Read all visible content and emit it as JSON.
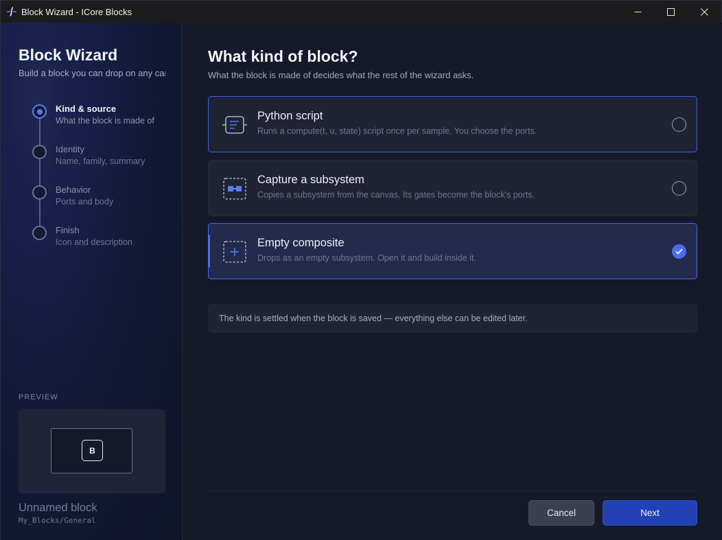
{
  "window": {
    "title": "Block Wizard - ICore Blocks",
    "icons": {
      "app": "app-logo-icon",
      "minimize": "minimize-icon",
      "maximize": "maximize-icon",
      "close": "close-icon"
    }
  },
  "sidebar": {
    "title": "Block Wizard",
    "subtitle": "Build a block you can drop on any canvas",
    "steps": [
      {
        "title": "Kind & source",
        "desc": "What the block is made of",
        "active": true
      },
      {
        "title": "Identity",
        "desc": "Name, family, summary",
        "active": false
      },
      {
        "title": "Behavior",
        "desc": "Ports and body",
        "active": false
      },
      {
        "title": "Finish",
        "desc": "Icon and description",
        "active": false
      }
    ],
    "preview": {
      "label": "PREVIEW",
      "badge": "B",
      "name": "Unnamed block",
      "path": "My_Blocks/General"
    }
  },
  "main": {
    "title": "What kind of block?",
    "subtitle": "What the block is made of decides what the rest of the wizard asks.",
    "options": [
      {
        "title": "Python script",
        "desc": "Runs a compute(t, u, state) script once per sample. You choose the ports.",
        "icon": "python-script-icon",
        "selected": false
      },
      {
        "title": "Capture a subsystem",
        "desc": "Copies a subsystem from the canvas. Its gates become the block's ports.",
        "icon": "capture-subsystem-icon",
        "selected": false
      },
      {
        "title": "Empty composite",
        "desc": "Drops as an empty subsystem. Open it and build inside it.",
        "icon": "empty-composite-icon",
        "selected": true
      }
    ],
    "note": "The kind is settled when the block is saved — everything else can be edited later."
  },
  "footer": {
    "cancel": "Cancel",
    "next": "Next"
  },
  "colors": {
    "accent": "#4a6df2",
    "primary_button": "#2141b4"
  }
}
